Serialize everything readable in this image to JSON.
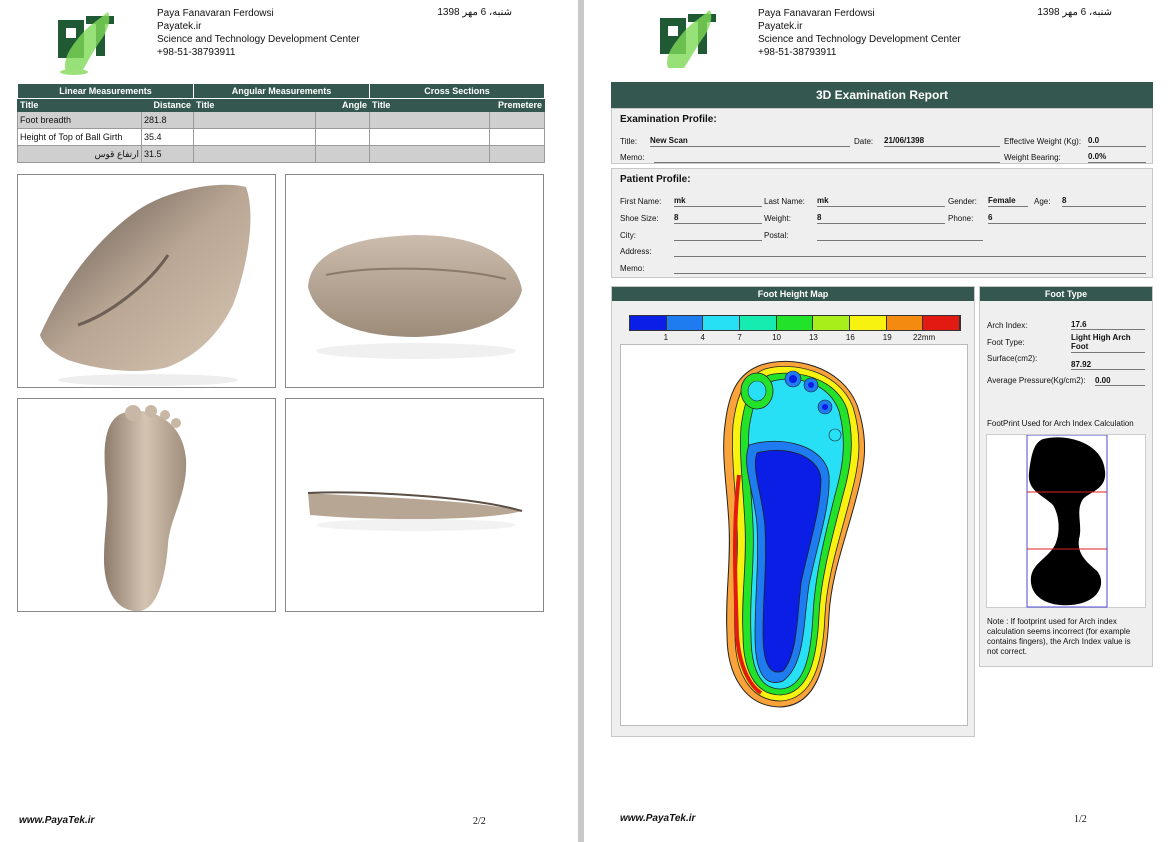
{
  "company": {
    "name": "Paya Fanavaran Ferdowsi",
    "site": "Payatek.ir",
    "center": "Science and Technology Development Center",
    "phone": "+98-51-38793911",
    "date": "شنبه، 6 مهر 1398",
    "footer_url": "www.PayaTek.ir"
  },
  "left_page": {
    "page_number": "2/2",
    "groups": [
      "Linear Measurements",
      "Angular Measurements",
      "Cross Sections"
    ],
    "subheaders": [
      "Title",
      "Distance",
      "Title",
      "Angle",
      "Title",
      "Premetere"
    ],
    "rows": [
      {
        "title": "Foot breadth",
        "value": "281.8"
      },
      {
        "title": "Height of Top of Ball Girth",
        "value": "35.4"
      },
      {
        "title": "ارتفاع قوس",
        "value": "31.5"
      }
    ]
  },
  "right_page": {
    "page_number": "1/2",
    "report_title": "3D Examination Report",
    "exam": {
      "heading": "Examination Profile:",
      "title_label": "Title:",
      "title_value": "New Scan",
      "date_label": "Date:",
      "date_value": "21/06/1398",
      "weight_label": "Effective Weight (Kg):",
      "weight_value": "0.0",
      "memo_label": "Memo:",
      "bearing_label": "Weight Bearing:",
      "bearing_value": "0.0%"
    },
    "patient": {
      "heading": "Patient Profile:",
      "first_label": "First Name:",
      "first_value": "mk",
      "last_label": "Last Name:",
      "last_value": "mk",
      "gender_label": "Gender:",
      "gender_value": "Female",
      "age_label": "Age:",
      "age_value": "8",
      "shoe_label": "Shoe Size:",
      "shoe_value": "8",
      "weight_label": "Weight:",
      "weight_value": "8",
      "phone_label": "Phone:",
      "phone_value": "6",
      "city_label": "City:",
      "postal_label": "Postal:",
      "address_label": "Address:",
      "memo_label": "Memo:"
    },
    "height_map": {
      "title": "Foot Height Map",
      "legend_labels": [
        "1",
        "4",
        "7",
        "10",
        "13",
        "16",
        "19",
        "22mm"
      ],
      "legend_colors": [
        "#0a1ee6",
        "#1e7bf0",
        "#28e0f5",
        "#16ecb0",
        "#23e22a",
        "#a8ee1a",
        "#f7f20f",
        "#f48a10",
        "#e31a12"
      ]
    },
    "foot_type": {
      "title": "Foot Type",
      "arch_index_label": "Arch Index:",
      "arch_index_value": "17.6",
      "type_label": "Foot Type:",
      "type_value_1": "Light High Arch",
      "type_value_2": "Foot",
      "surface_label": "Surface(cm2):",
      "surface_value": "87.92",
      "pressure_label": "Average Pressure(Kg/cm2):",
      "pressure_value": "0.00",
      "footprint_caption": "FootPrint Used for Arch Index Calculation",
      "note_1": "Note : If footprint used for Arch index",
      "note_2": "calculation seems incorrect (for example",
      "note_3": "contains fingers), the Arch Index value is",
      "note_4": "not correct."
    }
  }
}
